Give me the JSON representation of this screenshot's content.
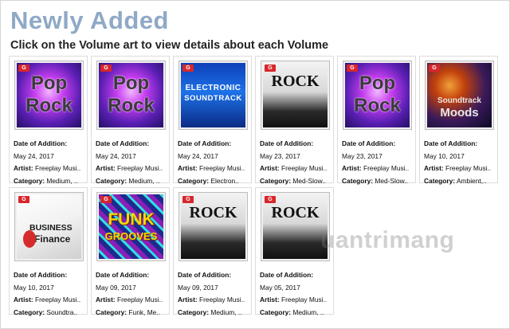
{
  "header": {
    "title": "Newly Added",
    "subtitle": "Click on the Volume art to view details about each Volume"
  },
  "labels": {
    "date": "Date of Addition:",
    "artist": "Artist:",
    "category": "Category:"
  },
  "volumes": [
    {
      "art_text_1": "Pop",
      "art_text_2": "Rock",
      "date": "May 24, 2017",
      "artist": "Freeplay Musi..",
      "category": "Medium, .."
    },
    {
      "art_text_1": "Pop",
      "art_text_2": "Rock",
      "date": "May 24, 2017",
      "artist": "Freeplay Musi..",
      "category": "Medium, .."
    },
    {
      "art_text_1": "ELECTRONIC",
      "art_text_2": "SOUNDTRACK",
      "date": "May 24, 2017",
      "artist": "Freeplay Musi..",
      "category": "Electron.."
    },
    {
      "art_text_1": "ROCK",
      "art_text_2": "",
      "date": "May 23, 2017",
      "artist": "Freeplay Musi..",
      "category": "Med-Slow.."
    },
    {
      "art_text_1": "Pop",
      "art_text_2": "Rock",
      "date": "May 23, 2017",
      "artist": "Freeplay Musi..",
      "category": "Med-Slow.."
    },
    {
      "art_text_1": "Soundtrack",
      "art_text_2": "Moods",
      "date": "May 10, 2017",
      "artist": "Freeplay Musi..",
      "category": "Ambient,.."
    },
    {
      "art_text_1": "BUSINESS",
      "art_text_2": "Finance",
      "date": "May 10, 2017",
      "artist": "Freeplay Musi..",
      "category": "Soundtra.."
    },
    {
      "art_text_1": "FUNK",
      "art_text_2": "GROOVES",
      "date": "May 09, 2017",
      "artist": "Freeplay Musi..",
      "category": "Funk, Me.."
    },
    {
      "art_text_1": "ROCK",
      "art_text_2": "",
      "date": "May 09, 2017",
      "artist": "Freeplay Musi..",
      "category": "Medium, .."
    },
    {
      "art_text_1": "ROCK",
      "art_text_2": "",
      "date": "May 05, 2017",
      "artist": "Freeplay Musi..",
      "category": "Medium, .."
    }
  ],
  "watermark": "uantrimang",
  "colors": {
    "title": "#8fa9c6",
    "badge": "#d8262c"
  }
}
